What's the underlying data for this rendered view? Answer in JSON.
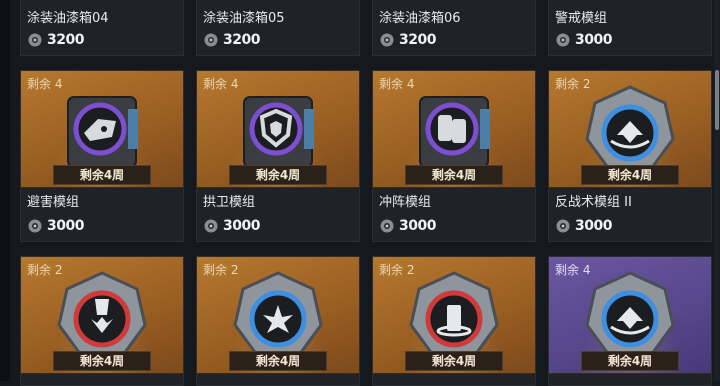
{
  "shop": {
    "row_top": [
      {
        "name": "涂装油漆箱04",
        "price": "3200"
      },
      {
        "name": "涂装油漆箱05",
        "price": "3200"
      },
      {
        "name": "涂装油漆箱06",
        "price": "3200"
      },
      {
        "name": "警戒模组",
        "price": "3000"
      }
    ],
    "row_mid": [
      {
        "remain": "剩余 4",
        "banner": "剩余4周",
        "name": "避害模组",
        "price": "3000",
        "icon": "car-chip-icon",
        "accent": "#7b4fd0"
      },
      {
        "remain": "剩余 4",
        "banner": "剩余4周",
        "name": "拱卫模组",
        "price": "3000",
        "icon": "shield-chip-icon",
        "accent": "#7b4fd0"
      },
      {
        "remain": "剩余 4",
        "banner": "剩余4周",
        "name": "冲阵模组",
        "price": "3000",
        "icon": "barrier-chip-icon",
        "accent": "#7b4fd0"
      },
      {
        "remain": "剩余 2",
        "banner": "剩余4周",
        "name": "反战术模组 II",
        "price": "3000",
        "icon": "counter-tactics-medal-icon",
        "accent": "#3f8fe0"
      }
    ],
    "row_bot": [
      {
        "remain": "剩余 2",
        "banner": "剩余4周",
        "icon": "drill-medal-icon",
        "accent": "#d03a3a",
        "purple": false
      },
      {
        "remain": "剩余 2",
        "banner": "剩余4周",
        "icon": "blast-medal-icon",
        "accent": "#3f8fe0",
        "purple": false
      },
      {
        "remain": "剩余 2",
        "banner": "剩余4周",
        "icon": "pillar-medal-icon",
        "accent": "#d03a3a",
        "purple": false
      },
      {
        "remain": "剩余 4",
        "banner": "剩余4周",
        "icon": "counter-tactics-medal-icon",
        "accent": "#3f8fe0",
        "purple": true
      }
    ]
  },
  "colors": {
    "card_art_orange": "#b5792f",
    "card_art_purple": "#6b57a0",
    "card_bg": "#1f2226"
  }
}
